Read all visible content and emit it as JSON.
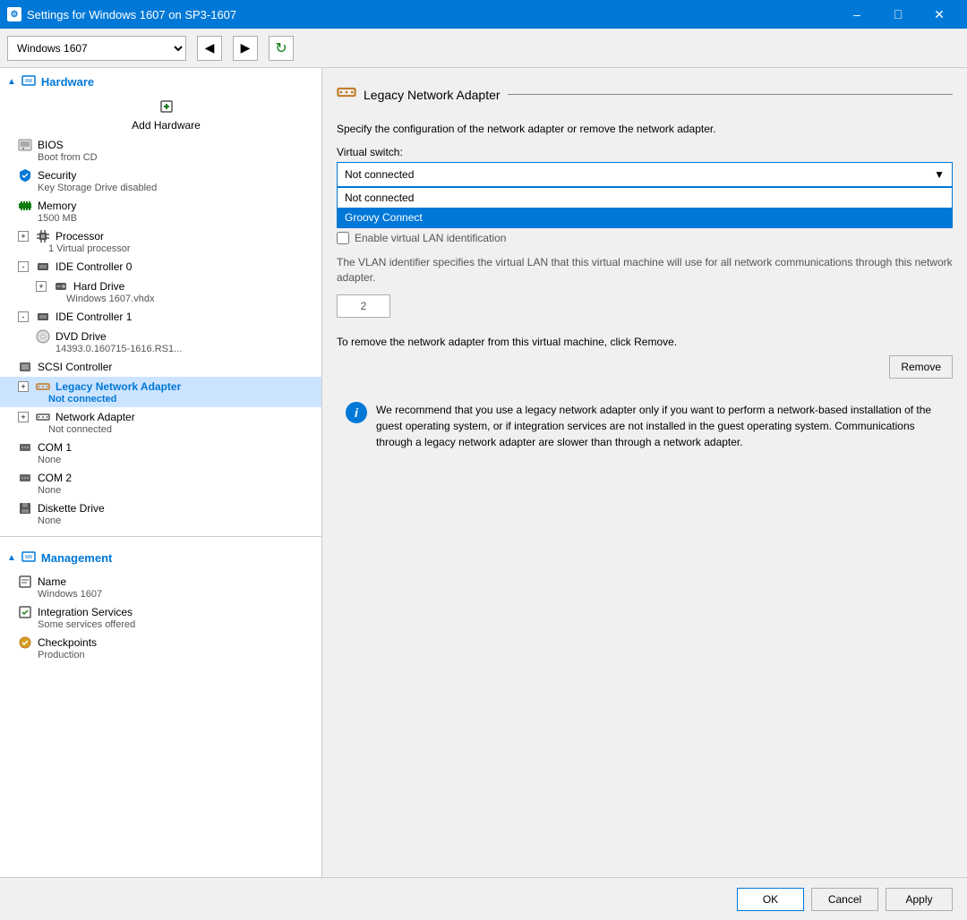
{
  "window": {
    "title": "Settings for Windows 1607 on SP3-1607",
    "icon": "⚙"
  },
  "toolbar": {
    "vm_options": [
      "Windows 1607"
    ],
    "vm_selected": "Windows 1607",
    "back_label": "◀",
    "forward_label": "▶",
    "refresh_label": "↺"
  },
  "sidebar": {
    "hardware_label": "Hardware",
    "management_label": "Management",
    "items": [
      {
        "id": "add-hardware",
        "label": "Add Hardware",
        "sub": "",
        "indent": 1,
        "icon": "add"
      },
      {
        "id": "bios",
        "label": "BIOS",
        "sub": "Boot from CD",
        "indent": 1,
        "icon": "bios"
      },
      {
        "id": "security",
        "label": "Security",
        "sub": "Key Storage Drive disabled",
        "indent": 1,
        "icon": "security"
      },
      {
        "id": "memory",
        "label": "Memory",
        "sub": "1500 MB",
        "indent": 1,
        "icon": "memory"
      },
      {
        "id": "processor",
        "label": "Processor",
        "sub": "1 Virtual processor",
        "indent": 1,
        "icon": "processor",
        "expand": true
      },
      {
        "id": "ide0",
        "label": "IDE Controller 0",
        "sub": "",
        "indent": 1,
        "icon": "ide",
        "expand": true,
        "expanded": true
      },
      {
        "id": "hard-drive",
        "label": "Hard Drive",
        "sub": "Windows 1607.vhdx",
        "indent": 2,
        "icon": "harddrive",
        "expand": true
      },
      {
        "id": "ide1",
        "label": "IDE Controller 1",
        "sub": "",
        "indent": 1,
        "icon": "ide",
        "expand": true,
        "expanded": true
      },
      {
        "id": "dvd-drive",
        "label": "DVD Drive",
        "sub": "14393.0.160715-1616.RS1...",
        "indent": 2,
        "icon": "dvd"
      },
      {
        "id": "scsi",
        "label": "SCSI Controller",
        "sub": "",
        "indent": 1,
        "icon": "scsi"
      },
      {
        "id": "legacy-network",
        "label": "Legacy Network Adapter",
        "sub": "Not connected",
        "indent": 1,
        "icon": "network",
        "expand": true,
        "active": true
      },
      {
        "id": "network-adapter",
        "label": "Network Adapter",
        "sub": "Not connected",
        "indent": 1,
        "icon": "network-adapter",
        "expand": true
      },
      {
        "id": "com1",
        "label": "COM 1",
        "sub": "None",
        "indent": 1,
        "icon": "com"
      },
      {
        "id": "com2",
        "label": "COM 2",
        "sub": "None",
        "indent": 1,
        "icon": "com"
      },
      {
        "id": "diskette",
        "label": "Diskette Drive",
        "sub": "None",
        "indent": 1,
        "icon": "diskette"
      }
    ],
    "management_items": [
      {
        "id": "name",
        "label": "Name",
        "sub": "Windows 1607",
        "indent": 1,
        "icon": "name"
      },
      {
        "id": "integration",
        "label": "Integration Services",
        "sub": "Some services offered",
        "indent": 1,
        "icon": "integration"
      },
      {
        "id": "checkpoints",
        "label": "Checkpoints",
        "sub": "Production",
        "indent": 1,
        "icon": "checkpoints"
      }
    ]
  },
  "main": {
    "section_icon": "🔌",
    "section_title": "Legacy Network Adapter",
    "description": "Specify the configuration of the network adapter or remove the network adapter.",
    "virtual_switch_label": "Virtual switch:",
    "virtual_switch_selected": "Not connected",
    "virtual_switch_options": [
      {
        "value": "Not connected",
        "label": "Not connected"
      },
      {
        "value": "Groovy Connect",
        "label": "Groovy Connect"
      }
    ],
    "dropdown_open": true,
    "option_not_connected": "Not connected",
    "option_groovy_connect": "Groovy Connect",
    "vlan_checkbox_label": "Enable virtual LAN identification",
    "vlan_description": "The VLAN identifier specifies the virtual LAN that this virtual machine will use for all network communications through this network adapter.",
    "vlan_value": "2",
    "remove_description": "To remove the network adapter from this virtual machine, click Remove.",
    "remove_button": "Remove",
    "info_text": "We recommend that you use a legacy network adapter only if you want to perform a network-based installation of the guest operating system, or if integration services are not installed in the guest operating system. Communications through a legacy network adapter are slower than through a network adapter."
  },
  "footer": {
    "ok_label": "OK",
    "cancel_label": "Cancel",
    "apply_label": "Apply"
  }
}
